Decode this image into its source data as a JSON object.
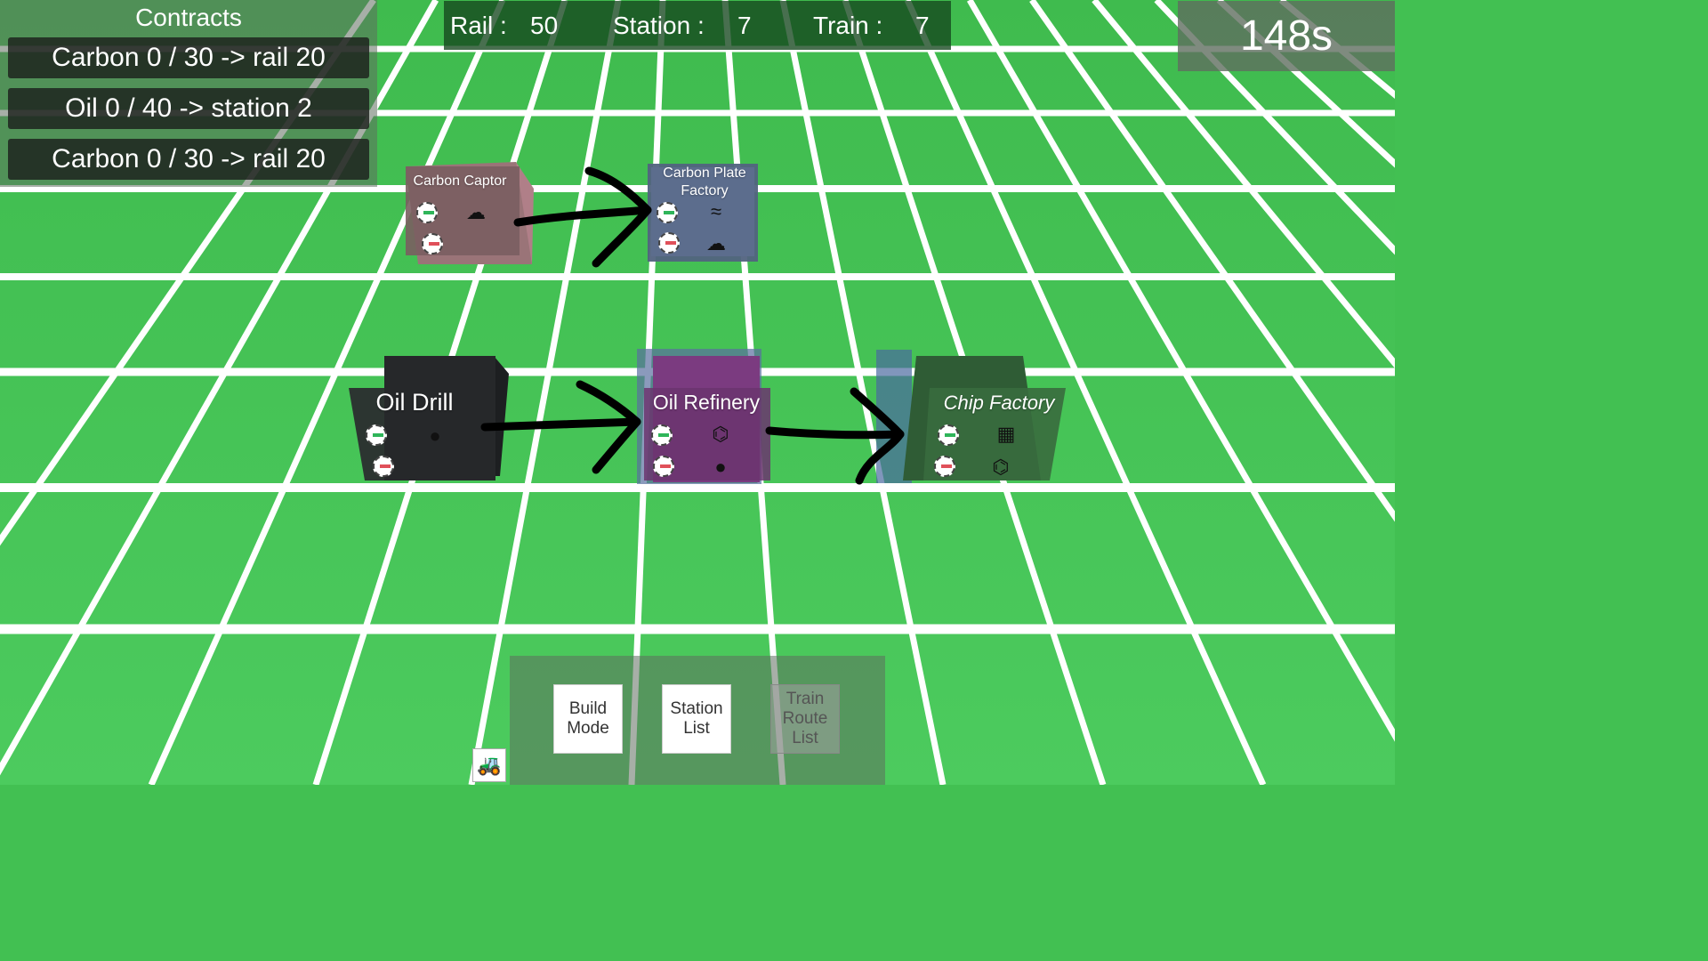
{
  "contracts": {
    "title": "Contracts",
    "items": [
      "Carbon 0 / 30 -> rail 20",
      "Oil 0 / 40 -> station 2",
      "Carbon 0 / 30 -> rail 20"
    ]
  },
  "resources": {
    "rail_label": "Rail :",
    "rail_value": "50",
    "station_label": "Station :",
    "station_value": "7",
    "train_label": "Train :",
    "train_value": "7"
  },
  "timer": "148s",
  "buildings": {
    "carbon_captor": {
      "label": "Carbon Captor",
      "output_icon": "co2-cloud-icon"
    },
    "carbon_plate_factory": {
      "label": "Carbon Plate Factory",
      "output_icon": "plate-icon",
      "input_icon": "co2-cloud-icon"
    },
    "oil_drill": {
      "label": "Oil Drill",
      "output_icon": "oil-drop-icon"
    },
    "oil_refinery": {
      "label": "Oil Refinery",
      "output_icon": "molecule-icon",
      "input_icon": "oil-drop-icon"
    },
    "chip_factory": {
      "label": "Chip Factory",
      "output_icon": "chip-icon",
      "input_icon": "molecule-icon"
    }
  },
  "toolbar": {
    "build_mode": "Build\nMode",
    "station_list": "Station\nList",
    "train_route_list": "Train\nRoute\nList"
  },
  "colors": {
    "grass": "#42c052",
    "grid_line": "#ffffff",
    "carbon_captor": "#8c6d6d",
    "carbon_plate_factory": "#5c6d8d",
    "oil_drill": "#2b2d2f",
    "oil_refinery": "#7b3b80",
    "chip_factory": "#386b3e"
  }
}
